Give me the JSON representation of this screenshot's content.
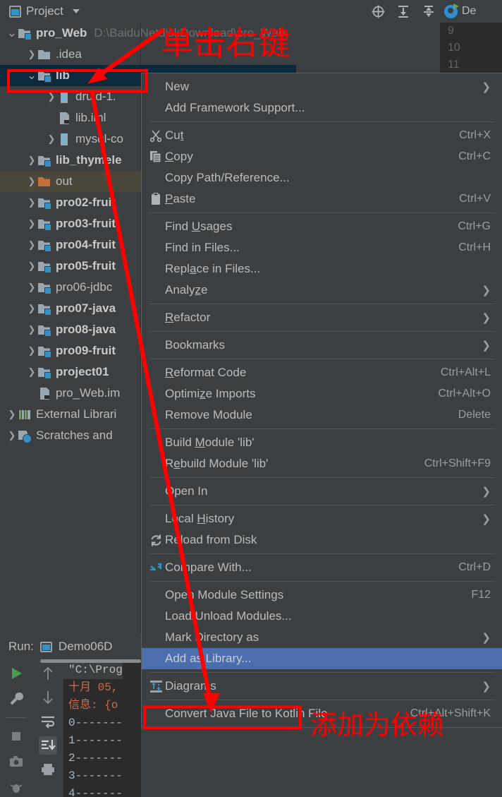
{
  "toolwindow": {
    "title": "Project",
    "dropdown_caret": "▾",
    "icons": [
      {
        "name": "locate-icon",
        "glyph": "⊕"
      },
      {
        "name": "expand-all-icon",
        "glyph": "⤓"
      },
      {
        "name": "collapse-all-icon",
        "glyph": "⤒"
      },
      {
        "name": "settings-gear-icon",
        "glyph": "✱"
      },
      {
        "name": "hide-icon",
        "glyph": "—"
      }
    ]
  },
  "editor": {
    "tab_label": "De",
    "tab_icon": "debug-icon",
    "gutter_lines": [
      "9",
      "10",
      "11"
    ]
  },
  "tree": {
    "items": [
      {
        "label": "pro_Web",
        "sub": "D:\\BaiduNetdiskDownload\\pro_Web",
        "arrow": "v",
        "icon": "module-icon",
        "indent": 0,
        "bold": true,
        "state": "normal"
      },
      {
        "label": ".idea",
        "sub": "",
        "arrow": ">",
        "icon": "folder-icon",
        "indent": 1,
        "bold": false,
        "state": "normal"
      },
      {
        "label": "lib",
        "sub": "",
        "arrow": "v",
        "icon": "module-icon",
        "indent": 1,
        "bold": true,
        "state": "selected"
      },
      {
        "label": "druid-1.",
        "sub": "",
        "arrow": ">",
        "icon": "jar-icon",
        "indent": 2,
        "bold": false,
        "state": "normal"
      },
      {
        "label": "lib.iml",
        "sub": "",
        "arrow": "",
        "icon": "iml-icon",
        "indent": 2,
        "bold": false,
        "state": "normal"
      },
      {
        "label": "mysql-co",
        "sub": "",
        "arrow": ">",
        "icon": "jar-icon",
        "indent": 2,
        "bold": false,
        "state": "normal"
      },
      {
        "label": "lib_thymele",
        "sub": "",
        "arrow": ">",
        "icon": "module-icon",
        "indent": 1,
        "bold": true,
        "state": "normal"
      },
      {
        "label": "out",
        "sub": "",
        "arrow": ">",
        "icon": "folder-orange-icon",
        "indent": 1,
        "bold": false,
        "state": "olive"
      },
      {
        "label": "pro02-fruit",
        "sub": "",
        "arrow": ">",
        "icon": "module-icon",
        "indent": 1,
        "bold": true,
        "state": "normal"
      },
      {
        "label": "pro03-fruit",
        "sub": "",
        "arrow": ">",
        "icon": "module-icon",
        "indent": 1,
        "bold": true,
        "state": "normal"
      },
      {
        "label": "pro04-fruit",
        "sub": "",
        "arrow": ">",
        "icon": "module-icon",
        "indent": 1,
        "bold": true,
        "state": "normal"
      },
      {
        "label": "pro05-fruit",
        "sub": "",
        "arrow": ">",
        "icon": "module-icon",
        "indent": 1,
        "bold": true,
        "state": "normal"
      },
      {
        "label": "pro06-jdbc",
        "sub": "",
        "arrow": ">",
        "icon": "module-icon",
        "indent": 1,
        "bold": false,
        "state": "normal"
      },
      {
        "label": "pro07-java",
        "sub": "",
        "arrow": ">",
        "icon": "module-icon",
        "indent": 1,
        "bold": true,
        "state": "normal"
      },
      {
        "label": "pro08-java",
        "sub": "",
        "arrow": ">",
        "icon": "module-icon",
        "indent": 1,
        "bold": true,
        "state": "normal"
      },
      {
        "label": "pro09-fruit",
        "sub": "",
        "arrow": ">",
        "icon": "module-icon",
        "indent": 1,
        "bold": true,
        "state": "normal"
      },
      {
        "label": "project01",
        "sub": "",
        "arrow": ">",
        "icon": "module-icon",
        "indent": 1,
        "bold": true,
        "state": "normal"
      },
      {
        "label": "pro_Web.im",
        "sub": "",
        "arrow": "",
        "icon": "iml-icon",
        "indent": 1,
        "bold": false,
        "state": "normal"
      },
      {
        "label": "External Librari",
        "sub": "",
        "arrow": ">",
        "icon": "external-libraries-icon",
        "indent": 0,
        "bold": false,
        "state": "normal"
      },
      {
        "label": "Scratches and ",
        "sub": "",
        "arrow": ">",
        "icon": "scratches-icon",
        "indent": 0,
        "bold": false,
        "state": "normal"
      }
    ]
  },
  "context_menu": {
    "items": [
      {
        "type": "item",
        "label": "New",
        "mnemonic": "",
        "accel": "",
        "submenu": true,
        "icon": "",
        "highlight": false
      },
      {
        "type": "item",
        "label": "Add Framework Support...",
        "mnemonic": "",
        "accel": "",
        "submenu": false,
        "icon": "",
        "highlight": false
      },
      {
        "type": "separator"
      },
      {
        "type": "item",
        "label": "Cut",
        "mnemonic": "t",
        "accel": "Ctrl+X",
        "submenu": false,
        "icon": "cut-icon",
        "highlight": false
      },
      {
        "type": "item",
        "label": "Copy",
        "mnemonic": "C",
        "accel": "Ctrl+C",
        "submenu": false,
        "icon": "copy-icon",
        "highlight": false
      },
      {
        "type": "item",
        "label": "Copy Path/Reference...",
        "mnemonic": "",
        "accel": "",
        "submenu": false,
        "icon": "",
        "highlight": false
      },
      {
        "type": "item",
        "label": "Paste",
        "mnemonic": "P",
        "accel": "Ctrl+V",
        "submenu": false,
        "icon": "paste-icon",
        "highlight": false
      },
      {
        "type": "separator"
      },
      {
        "type": "item",
        "label": "Find Usages",
        "mnemonic": "U",
        "accel": "Ctrl+G",
        "submenu": false,
        "icon": "",
        "highlight": false
      },
      {
        "type": "item",
        "label": "Find in Files...",
        "mnemonic": "",
        "accel": "Ctrl+H",
        "submenu": false,
        "icon": "",
        "highlight": false
      },
      {
        "type": "item",
        "label": "Replace in Files...",
        "mnemonic": "a",
        "accel": "",
        "submenu": false,
        "icon": "",
        "highlight": false
      },
      {
        "type": "item",
        "label": "Analyze",
        "mnemonic": "z",
        "accel": "",
        "submenu": true,
        "icon": "",
        "highlight": false
      },
      {
        "type": "separator"
      },
      {
        "type": "item",
        "label": "Refactor",
        "mnemonic": "R",
        "accel": "",
        "submenu": true,
        "icon": "",
        "highlight": false
      },
      {
        "type": "separator"
      },
      {
        "type": "item",
        "label": "Bookmarks",
        "mnemonic": "",
        "accel": "",
        "submenu": true,
        "icon": "",
        "highlight": false
      },
      {
        "type": "separator"
      },
      {
        "type": "item",
        "label": "Reformat Code",
        "mnemonic": "R",
        "accel": "Ctrl+Alt+L",
        "submenu": false,
        "icon": "",
        "highlight": false
      },
      {
        "type": "item",
        "label": "Optimize Imports",
        "mnemonic": "z",
        "accel": "Ctrl+Alt+O",
        "submenu": false,
        "icon": "",
        "highlight": false
      },
      {
        "type": "item",
        "label": "Remove Module",
        "mnemonic": "",
        "accel": "Delete",
        "submenu": false,
        "icon": "",
        "highlight": false
      },
      {
        "type": "separator"
      },
      {
        "type": "item",
        "label": "Build Module 'lib'",
        "mnemonic": "M",
        "accel": "",
        "submenu": false,
        "icon": "",
        "highlight": false
      },
      {
        "type": "item",
        "label": "Rebuild Module 'lib'",
        "mnemonic": "e",
        "accel": "Ctrl+Shift+F9",
        "submenu": false,
        "icon": "",
        "highlight": false
      },
      {
        "type": "separator"
      },
      {
        "type": "item",
        "label": "Open In",
        "mnemonic": "",
        "accel": "",
        "submenu": true,
        "icon": "",
        "highlight": false
      },
      {
        "type": "separator"
      },
      {
        "type": "item",
        "label": "Local History",
        "mnemonic": "H",
        "accel": "",
        "submenu": true,
        "icon": "",
        "highlight": false
      },
      {
        "type": "item",
        "label": "Reload from Disk",
        "mnemonic": "",
        "accel": "",
        "submenu": false,
        "icon": "reload-icon",
        "highlight": false
      },
      {
        "type": "separator"
      },
      {
        "type": "item",
        "label": "Compare With...",
        "mnemonic": "",
        "accel": "Ctrl+D",
        "submenu": false,
        "icon": "compare-icon",
        "highlight": false
      },
      {
        "type": "separator"
      },
      {
        "type": "item",
        "label": "Open Module Settings",
        "mnemonic": "",
        "accel": "F12",
        "submenu": false,
        "icon": "",
        "highlight": false
      },
      {
        "type": "item",
        "label": "Load/Unload Modules...",
        "mnemonic": "",
        "accel": "",
        "submenu": false,
        "icon": "",
        "highlight": false
      },
      {
        "type": "item",
        "label": "Mark Directory as",
        "mnemonic": "",
        "accel": "",
        "submenu": true,
        "icon": "",
        "highlight": false
      },
      {
        "type": "item",
        "label": "Add as Library...",
        "mnemonic": "",
        "accel": "",
        "submenu": false,
        "icon": "",
        "highlight": true
      },
      {
        "type": "separator"
      },
      {
        "type": "item",
        "label": "Diagrams",
        "mnemonic": "",
        "accel": "",
        "submenu": true,
        "icon": "diagram-icon",
        "highlight": false
      },
      {
        "type": "separator"
      },
      {
        "type": "item",
        "label": "Convert Java File to Kotlin File",
        "mnemonic": "",
        "accel": "Ctrl+Alt+Shift+K",
        "submenu": false,
        "icon": "",
        "highlight": false
      }
    ]
  },
  "run_panel": {
    "header_label": "Run:",
    "config_name": "Demo06D",
    "console_lines": [
      {
        "text": "\"C:\\Prog",
        "style": "cmd"
      },
      {
        "text": "十月 05,",
        "style": "warn"
      },
      {
        "text": "信息: {o",
        "style": "warn"
      },
      {
        "text": "0-------",
        "style": "num"
      },
      {
        "text": "1-------",
        "style": "num"
      },
      {
        "text": "2-------",
        "style": "num"
      },
      {
        "text": "3-------",
        "style": "num"
      },
      {
        "text": "4-------",
        "style": "num"
      }
    ],
    "left_icons": [
      {
        "name": "run-icon",
        "glyph": "▶"
      },
      {
        "name": "wrench-icon",
        "glyph": "🔧"
      },
      {
        "name": "stop-icon",
        "glyph": "■"
      },
      {
        "name": "camera-icon",
        "glyph": "📷"
      },
      {
        "name": "bug-icon",
        "glyph": "✳"
      }
    ],
    "right_icons": [
      {
        "name": "arrow-up-icon",
        "glyph": "↑"
      },
      {
        "name": "arrow-down-icon",
        "glyph": "↓"
      },
      {
        "name": "soft-wrap-icon",
        "glyph": "⤸"
      },
      {
        "name": "scroll-to-end-icon",
        "glyph": "⤓"
      },
      {
        "name": "print-icon",
        "glyph": "🖶"
      }
    ]
  },
  "annotations": {
    "note_top": "单击右键",
    "note_bottom": "添加为依赖",
    "color": "#ff0000"
  }
}
